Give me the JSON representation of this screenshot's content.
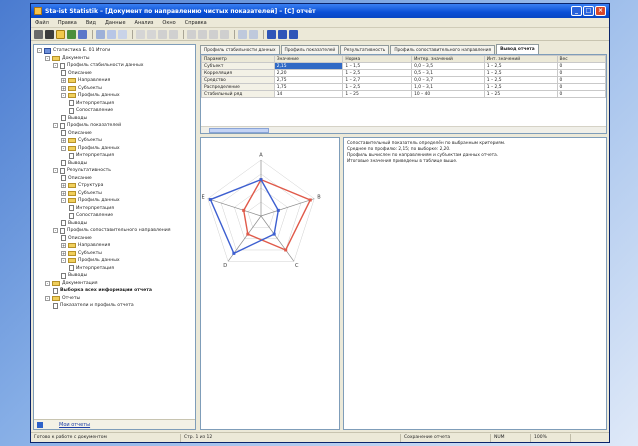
{
  "window": {
    "title": "Sta-ist Statistik – [Документ по направлению чистых показателей] – [C] отчёт",
    "buttons": [
      "_",
      "□",
      "×"
    ]
  },
  "menu": [
    "Файл",
    "Правка",
    "Вид",
    "Данные",
    "Анализ",
    "Окно",
    "Справка"
  ],
  "tree": {
    "items": [
      {
        "label": "Статистика Б. 01 Итоги",
        "level": 0,
        "kind": "root",
        "toggle": "-"
      },
      {
        "label": "Документы",
        "level": 1,
        "kind": "folder",
        "toggle": "-"
      },
      {
        "label": "Профиль стабильности данных",
        "level": 2,
        "kind": "doc",
        "toggle": "-"
      },
      {
        "label": "Описание",
        "level": 3,
        "kind": "doc",
        "toggle": ""
      },
      {
        "label": "Направления",
        "level": 3,
        "kind": "folder",
        "toggle": "+"
      },
      {
        "label": "Субъекты",
        "level": 3,
        "kind": "folder",
        "toggle": "+"
      },
      {
        "label": "Профиль данных",
        "level": 3,
        "kind": "folder",
        "toggle": "-"
      },
      {
        "label": "Интерпретация",
        "level": 4,
        "kind": "doc",
        "toggle": ""
      },
      {
        "label": "Сопоставление",
        "level": 4,
        "kind": "doc",
        "toggle": ""
      },
      {
        "label": "Выводы",
        "level": 3,
        "kind": "doc",
        "toggle": ""
      },
      {
        "label": "Профиль показателей",
        "level": 2,
        "kind": "doc",
        "toggle": "-"
      },
      {
        "label": "Описание",
        "level": 3,
        "kind": "doc",
        "toggle": ""
      },
      {
        "label": "Субъекты",
        "level": 3,
        "kind": "folder",
        "toggle": "+"
      },
      {
        "label": "Профиль данных",
        "level": 3,
        "kind": "folder",
        "toggle": "-"
      },
      {
        "label": "Интерпретация",
        "level": 4,
        "kind": "doc",
        "toggle": ""
      },
      {
        "label": "Выводы",
        "level": 3,
        "kind": "doc",
        "toggle": ""
      },
      {
        "label": "Результативность",
        "level": 2,
        "kind": "doc",
        "toggle": "-"
      },
      {
        "label": "Описание",
        "level": 3,
        "kind": "doc",
        "toggle": ""
      },
      {
        "label": "Структура",
        "level": 3,
        "kind": "folder",
        "toggle": "+"
      },
      {
        "label": "Субъекты",
        "level": 3,
        "kind": "folder",
        "toggle": "+"
      },
      {
        "label": "Профиль данных",
        "level": 3,
        "kind": "folder",
        "toggle": "-"
      },
      {
        "label": "Интерпретация",
        "level": 4,
        "kind": "doc",
        "toggle": ""
      },
      {
        "label": "Сопоставление",
        "level": 4,
        "kind": "doc",
        "toggle": ""
      },
      {
        "label": "Выводы",
        "level": 3,
        "kind": "doc",
        "toggle": ""
      },
      {
        "label": "Профиль сопоставительного направления",
        "level": 2,
        "kind": "doc",
        "toggle": "-"
      },
      {
        "label": "Описание",
        "level": 3,
        "kind": "doc",
        "toggle": ""
      },
      {
        "label": "Направления",
        "level": 3,
        "kind": "folder",
        "toggle": "+"
      },
      {
        "label": "Субъекты",
        "level": 3,
        "kind": "folder",
        "toggle": "+"
      },
      {
        "label": "Профиль данных",
        "level": 3,
        "kind": "folder",
        "toggle": "-"
      },
      {
        "label": "Интерпретация",
        "level": 4,
        "kind": "doc",
        "toggle": ""
      },
      {
        "label": "Выводы",
        "level": 3,
        "kind": "doc",
        "toggle": ""
      },
      {
        "label": "Документация",
        "level": 1,
        "kind": "folder",
        "toggle": "-"
      },
      {
        "label": "Выборка всех информации отчета",
        "level": 2,
        "kind": "doc",
        "toggle": "",
        "bold": true
      },
      {
        "label": "Отчеты",
        "level": 1,
        "kind": "folder",
        "toggle": "-"
      },
      {
        "label": "Показатели и профиль отчета",
        "level": 2,
        "kind": "doc",
        "toggle": ""
      }
    ],
    "footer_label": "Мои отчеты"
  },
  "tabs": [
    {
      "label": "Профиль стабильности данных"
    },
    {
      "label": "Профиль показателей"
    },
    {
      "label": "Результативность"
    },
    {
      "label": "Профиль сопоставительного направления"
    },
    {
      "label": "Вывод отчета",
      "active": true
    }
  ],
  "table": {
    "headers": [
      "Параметр",
      "Значение",
      "Норма",
      "Интер. значений",
      "Инт. значений",
      "Вес"
    ],
    "rows": [
      [
        "Субъект",
        "2,15",
        "1 – 1,5",
        "0,0 – 3,5",
        "1 – 2,5",
        "0"
      ],
      [
        "Корреляция",
        "2,20",
        "1 – 2,5",
        "0,5 – 3,1",
        "1 – 2,5",
        "0"
      ],
      [
        "Средство",
        "2,75",
        "1 – 2,7",
        "0,0 – 3,7",
        "1 – 2,5",
        "0"
      ],
      [
        "Распределение",
        "1,75",
        "1 – 2,5",
        "1,0 – 3,1",
        "1 – 2,5",
        "0"
      ],
      [
        "Стабильный ряд",
        "14",
        "1 – 25",
        "10 – 40",
        "1 – 25",
        "0"
      ]
    ]
  },
  "notes": [
    "Сопоставительный показатель определён по выбранным критериям.",
    "Среднее по профилю: 2,15; по выборке: 2,20.",
    "Профиль вычислен по направлениям и субъектам данных отчета.",
    "Итоговые значения приведены в таблице выше."
  ],
  "status": [
    "Готово к работе с документом",
    "Стр. 1 из 12",
    "Сохранение отчета",
    "NUM",
    "100%"
  ],
  "colors": {
    "series_a": "#e05a4a",
    "series_b": "#3d5fd0",
    "grid": "#8c8c8c"
  },
  "chart_data": {
    "type": "radar",
    "axes": [
      "A",
      "B",
      "C",
      "D",
      "E"
    ],
    "range": [
      0,
      4
    ],
    "series": [
      {
        "values": [
          2.6,
          3.7,
          3.0,
          1.6,
          1.3
        ]
      },
      {
        "values": [
          2.6,
          1.3,
          1.6,
          3.3,
          3.8
        ]
      }
    ]
  }
}
